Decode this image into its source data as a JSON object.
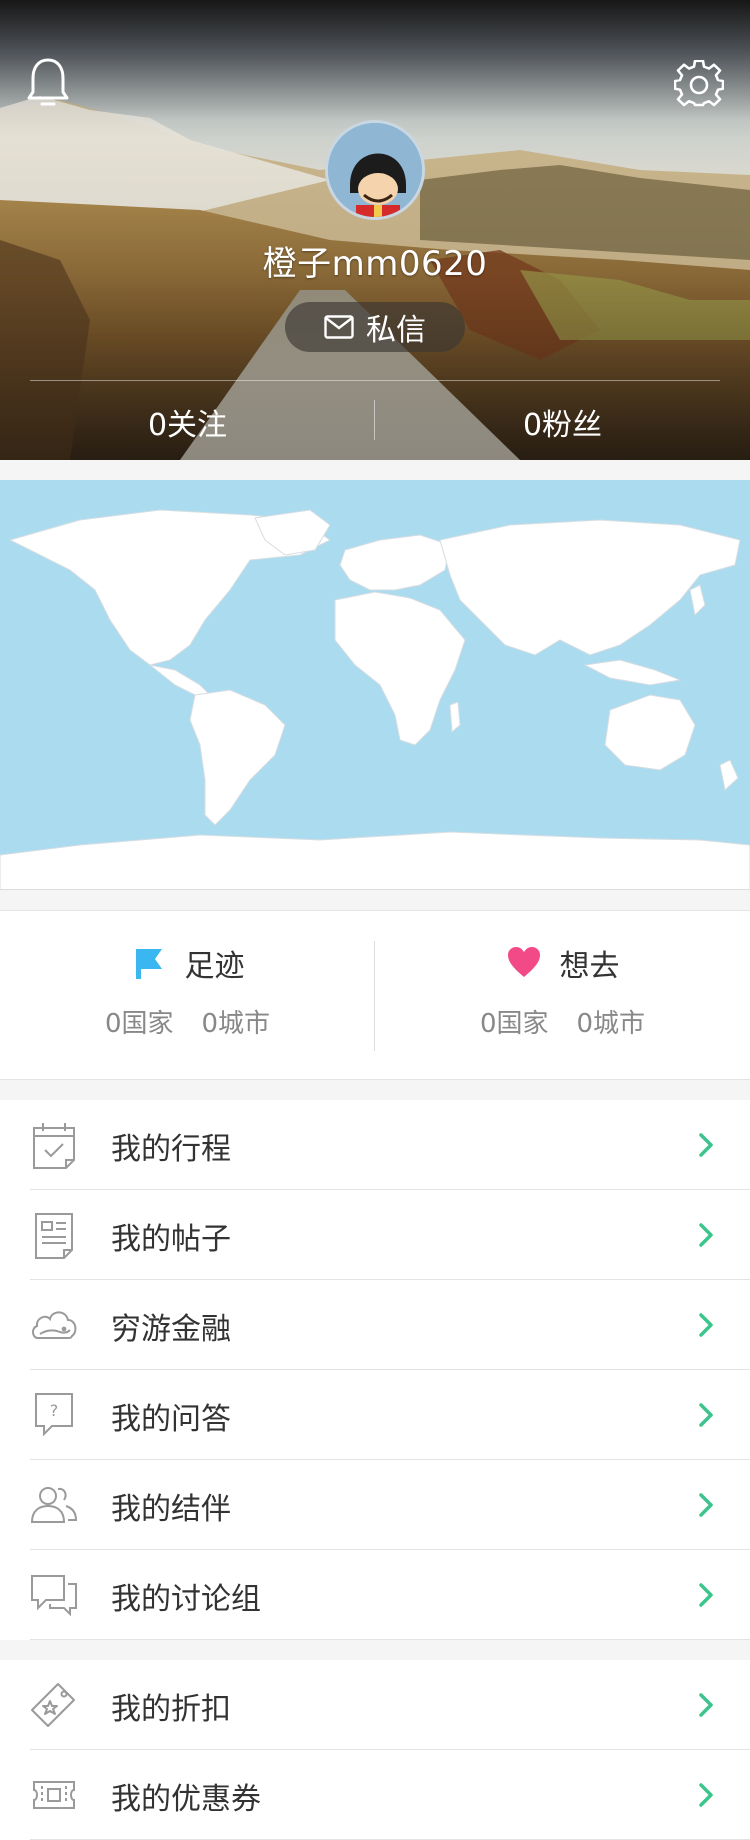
{
  "profile": {
    "username": "橙子mm0620",
    "message_button": "私信",
    "following": "0关注",
    "followers": "0粉丝"
  },
  "footprint": {
    "visited": {
      "title": "足迹",
      "countries": "0国家",
      "cities": "0城市"
    },
    "wishlist": {
      "title": "想去",
      "countries": "0国家",
      "cities": "0城市"
    }
  },
  "menu_group_1": [
    {
      "label": "我的行程",
      "icon": "calendar-icon"
    },
    {
      "label": "我的帖子",
      "icon": "document-icon"
    },
    {
      "label": "穷游金融",
      "icon": "cloud-icon"
    },
    {
      "label": "我的问答",
      "icon": "question-bubble-icon"
    },
    {
      "label": "我的结伴",
      "icon": "people-icon"
    },
    {
      "label": "我的讨论组",
      "icon": "chat-bubbles-icon"
    }
  ],
  "menu_group_2": [
    {
      "label": "我的折扣",
      "icon": "tag-icon"
    },
    {
      "label": "我的优惠券",
      "icon": "ticket-icon"
    }
  ],
  "colors": {
    "accent_green": "#3cc48c",
    "flag_blue": "#3ab6f0",
    "heart_pink": "#f24a86",
    "map_ocean": "#aadbef"
  }
}
